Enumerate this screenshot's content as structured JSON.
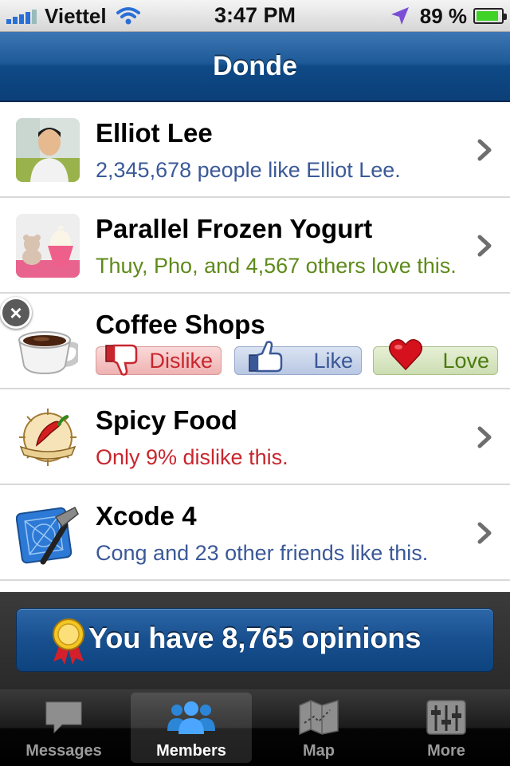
{
  "status_bar": {
    "carrier": "Viettel",
    "time": "3:47 PM",
    "battery": "89 %",
    "battery_level": 0.89
  },
  "nav": {
    "title": "Donde"
  },
  "rows": [
    {
      "title": "Elliot Lee",
      "subtitle": "2,345,678 people like Elliot Lee.",
      "subtitle_color": "#3b5998",
      "icon": "person-photo"
    },
    {
      "title": "Parallel Frozen Yogurt",
      "subtitle": "Thuy, Pho, and 4,567 others love this.",
      "subtitle_color": "#5e8a1a",
      "icon": "frozen-yogurt-photo"
    },
    {
      "title": "Coffee Shops",
      "icon": "coffee-cup-icon"
    },
    {
      "title": "Spicy Food",
      "subtitle": "Only 9% dislike this.",
      "subtitle_color": "#c8262e",
      "icon": "chili-pepper-icon"
    },
    {
      "title": "Xcode 4",
      "subtitle": "Cong and 23 other friends like this.",
      "subtitle_color": "#3b5998",
      "icon": "xcode-hammer-icon"
    }
  ],
  "vote": {
    "dislike": "Dislike",
    "like": "Like",
    "love": "Love"
  },
  "banner": {
    "text": "You have 8,765 opinions"
  },
  "tabs": [
    {
      "label": "Messages",
      "icon": "speech-bubble-icon",
      "active": false
    },
    {
      "label": "Members",
      "icon": "members-icon",
      "active": true
    },
    {
      "label": "Map",
      "icon": "map-icon",
      "active": false
    },
    {
      "label": "More",
      "icon": "sliders-icon",
      "active": false
    }
  ]
}
